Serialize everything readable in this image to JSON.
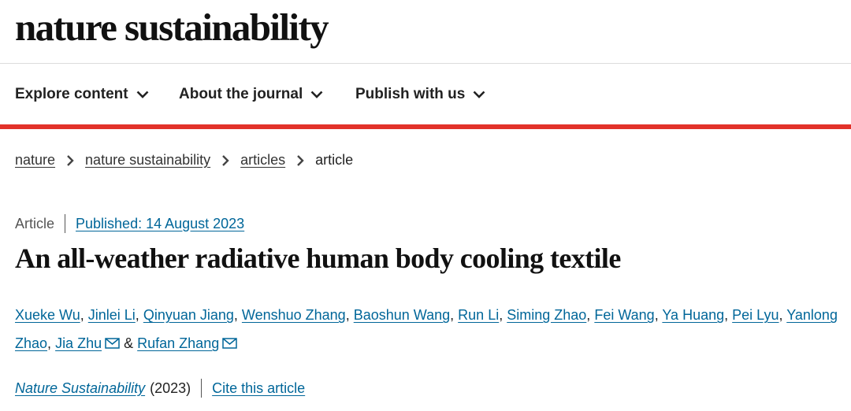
{
  "header": {
    "logo_text": "nature sustainability"
  },
  "nav": {
    "items": [
      {
        "label": "Explore content"
      },
      {
        "label": "About the journal"
      },
      {
        "label": "Publish with us"
      }
    ],
    "accent_color": "#e2322a"
  },
  "breadcrumb": {
    "items": [
      "nature",
      "nature sustainability",
      "articles"
    ],
    "current": "article"
  },
  "article": {
    "type": "Article",
    "published": "Published: 14 August 2023",
    "title": "An all-weather radiative human body cooling textile",
    "authors": [
      "Xueke Wu",
      "Jinlei Li",
      "Qinyuan Jiang",
      "Wenshuo Zhang",
      "Baoshun Wang",
      "Run Li",
      "Siming Zhao",
      "Fei Wang",
      "Ya Huang",
      "Pei Lyu",
      "Yanlong Zhao",
      "Jia Zhu",
      "Rufan Zhang"
    ],
    "author_separator": ",",
    "and_text": "&",
    "journal": "Nature Sustainability",
    "year": "(2023)",
    "cite_label": "Cite this article"
  },
  "icons": {
    "chevron": "chevron-down-icon",
    "breadcrumb_separator": "chevron-right-icon",
    "email": "envelope-icon"
  },
  "colors": {
    "link": "#006699",
    "accent": "#e2322a"
  }
}
